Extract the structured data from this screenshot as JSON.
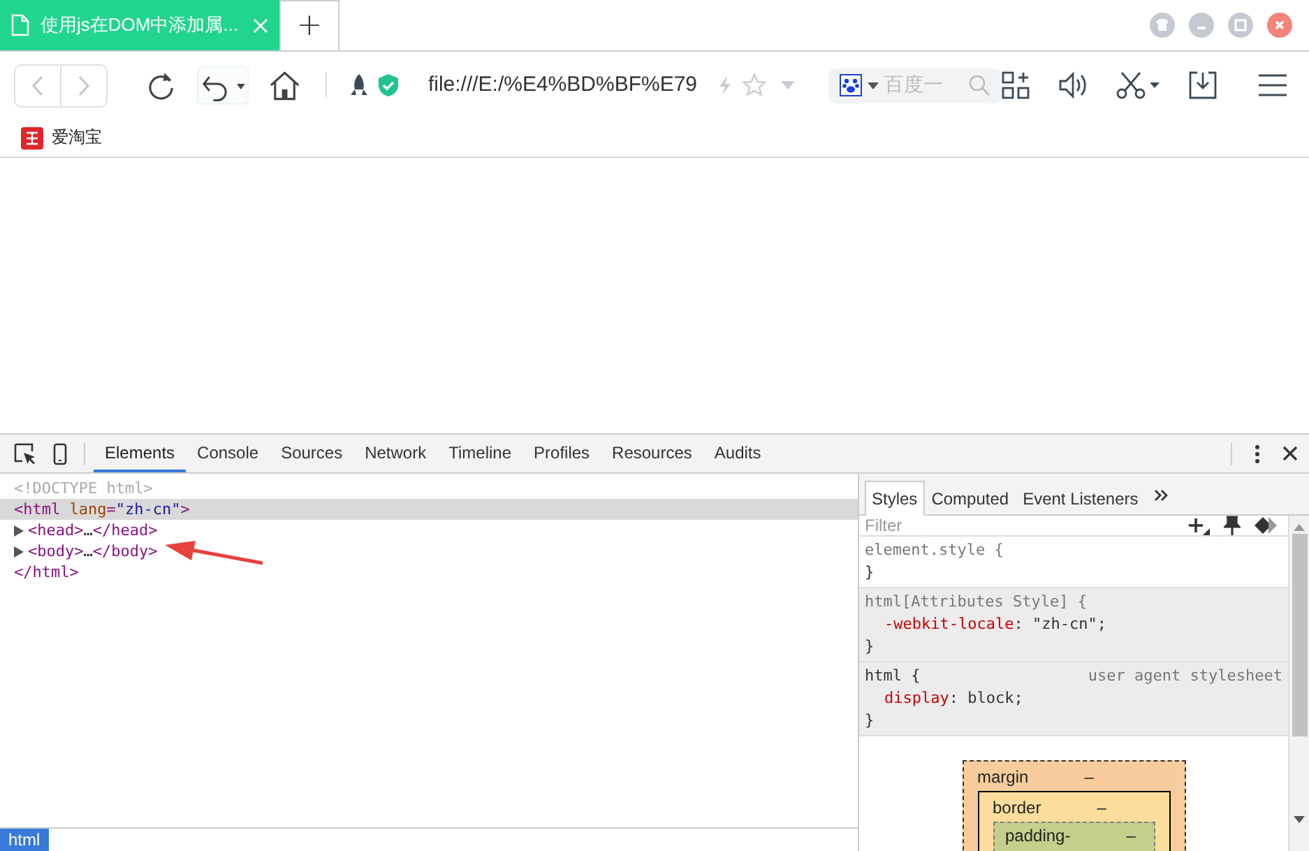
{
  "browser": {
    "tabs": [
      {
        "title": "使用js在DOM中添加属...",
        "selected": true
      }
    ],
    "new_tab": "+",
    "address": "file:///E:/%E4%BD%BF%E79",
    "search": {
      "placeholder": "百度一"
    },
    "bookmarks": [
      {
        "label": "爱淘宝"
      }
    ]
  },
  "devtools": {
    "tabs": [
      {
        "label": "Elements",
        "selected": true
      },
      {
        "label": "Console",
        "selected": false
      },
      {
        "label": "Sources",
        "selected": false
      },
      {
        "label": "Network",
        "selected": false
      },
      {
        "label": "Timeline",
        "selected": false
      },
      {
        "label": "Profiles",
        "selected": false
      },
      {
        "label": "Resources",
        "selected": false
      },
      {
        "label": "Audits",
        "selected": false
      }
    ],
    "dom": [
      {
        "selected": false,
        "expandable": false,
        "indent": false,
        "parts": [
          {
            "kind": "comment",
            "text": "<!DOCTYPE html>"
          }
        ]
      },
      {
        "selected": true,
        "expandable": false,
        "indent": false,
        "parts": [
          {
            "kind": "tag",
            "text": "<html"
          },
          {
            "kind": "attr",
            "text": " lang"
          },
          {
            "kind": "tag",
            "text": "="
          },
          {
            "kind": "value",
            "text": "\"zh-cn\""
          },
          {
            "kind": "tag",
            "text": ">"
          }
        ]
      },
      {
        "selected": false,
        "expandable": true,
        "indent": true,
        "parts": [
          {
            "kind": "tag",
            "text": "<head>"
          },
          {
            "kind": "plain",
            "text": "…"
          },
          {
            "kind": "tag",
            "text": "</head>"
          }
        ]
      },
      {
        "selected": false,
        "expandable": true,
        "indent": true,
        "parts": [
          {
            "kind": "tag",
            "text": "<body>"
          },
          {
            "kind": "plain",
            "text": "…"
          },
          {
            "kind": "tag",
            "text": "</body>"
          }
        ]
      },
      {
        "selected": false,
        "expandable": false,
        "indent": false,
        "parts": [
          {
            "kind": "tag",
            "text": "</html>"
          }
        ]
      }
    ],
    "breadcrumbs": [
      {
        "label": "html",
        "selected": true
      }
    ],
    "side_tabs": [
      {
        "label": "Styles",
        "selected": true
      },
      {
        "label": "Computed",
        "selected": false
      },
      {
        "label": "Event Listeners",
        "selected": false
      }
    ],
    "filter": {
      "placeholder": "Filter"
    },
    "rules": [
      {
        "kind": "inline",
        "selector": "element.style {",
        "close": "}"
      },
      {
        "kind": "attributes",
        "selector": "html[Attributes Style] {",
        "declarations": [
          {
            "property": "-webkit-locale",
            "value": ": \"zh-cn\";"
          }
        ],
        "close": "}"
      },
      {
        "kind": "user-agent",
        "selector": "html {",
        "source": "user agent stylesheet",
        "declarations": [
          {
            "property": "display",
            "value": ": block;"
          }
        ],
        "close": "}"
      }
    ],
    "box_model": [
      {
        "label": "margin",
        "value": "–"
      },
      {
        "label": "border",
        "value": "–"
      },
      {
        "label": "padding-",
        "value": "–"
      }
    ]
  }
}
